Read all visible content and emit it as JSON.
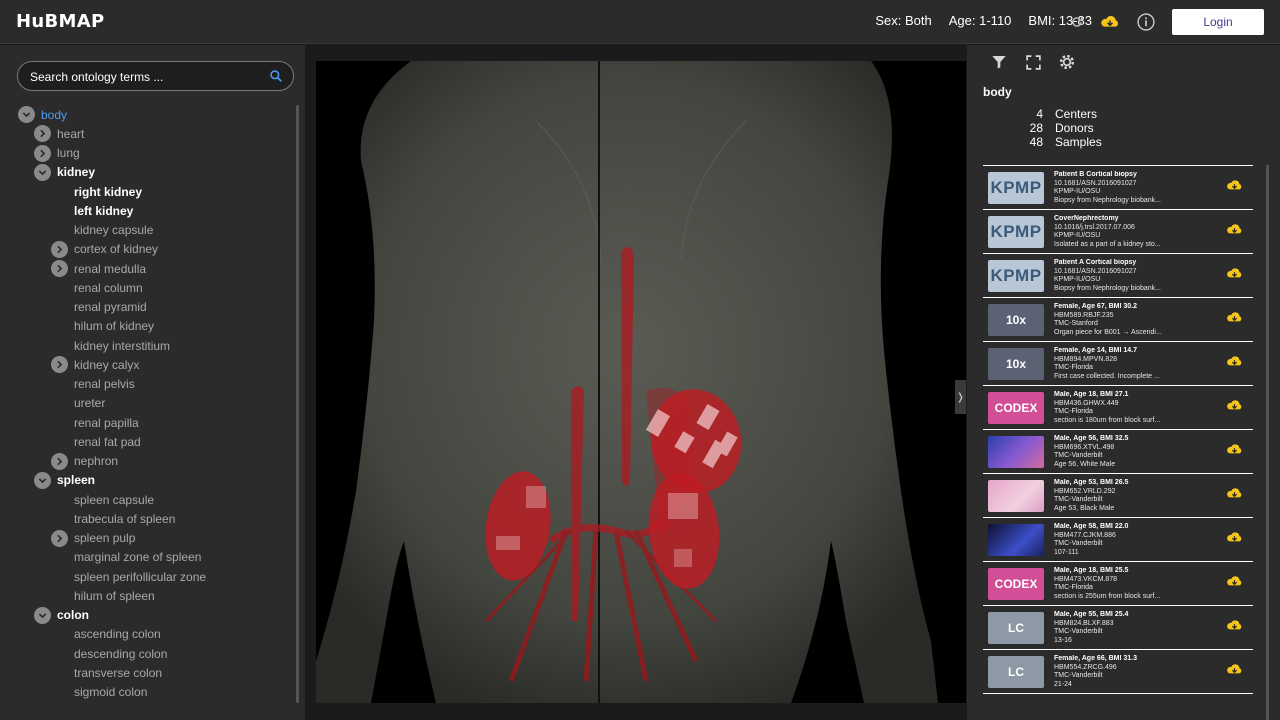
{
  "header": {
    "logo": "HuBMAP",
    "sex_filter": "Sex: Both",
    "age_filter": "Age: 1-110",
    "bmi_filter": "BMI: 13-83",
    "login_label": "Login",
    "icons": [
      "refresh-icon",
      "download-icon",
      "info-icon"
    ],
    "download_color": "#f5c518"
  },
  "search": {
    "placeholder": "Search ontology terms ..."
  },
  "tree": [
    {
      "label": "body",
      "level": 0,
      "toggle": "expanded",
      "style": "sel"
    },
    {
      "label": "heart",
      "level": 1,
      "toggle": "collapsed",
      "style": "dim"
    },
    {
      "label": "lung",
      "level": 1,
      "toggle": "collapsed",
      "style": "dim"
    },
    {
      "label": "kidney",
      "level": 1,
      "toggle": "expanded",
      "style": "bold"
    },
    {
      "label": "right kidney",
      "level": 2,
      "toggle": "none",
      "style": "bold"
    },
    {
      "label": "left kidney",
      "level": 2,
      "toggle": "none",
      "style": "bold"
    },
    {
      "label": "kidney capsule",
      "level": 2,
      "toggle": "none",
      "style": "dim"
    },
    {
      "label": "cortex of kidney",
      "level": 2,
      "toggle": "collapsed",
      "style": "dim"
    },
    {
      "label": "renal medulla",
      "level": 2,
      "toggle": "collapsed",
      "style": "dim"
    },
    {
      "label": "renal column",
      "level": 2,
      "toggle": "none",
      "style": "dim"
    },
    {
      "label": "renal pyramid",
      "level": 2,
      "toggle": "none",
      "style": "dim"
    },
    {
      "label": "hilum of kidney",
      "level": 2,
      "toggle": "none",
      "style": "dim"
    },
    {
      "label": "kidney interstitium",
      "level": 2,
      "toggle": "none",
      "style": "dim"
    },
    {
      "label": "kidney calyx",
      "level": 2,
      "toggle": "collapsed",
      "style": "dim"
    },
    {
      "label": "renal pelvis",
      "level": 2,
      "toggle": "none",
      "style": "dim"
    },
    {
      "label": "ureter",
      "level": 2,
      "toggle": "none",
      "style": "dim"
    },
    {
      "label": "renal papilla",
      "level": 2,
      "toggle": "none",
      "style": "dim"
    },
    {
      "label": "renal fat pad",
      "level": 2,
      "toggle": "none",
      "style": "dim"
    },
    {
      "label": "nephron",
      "level": 2,
      "toggle": "collapsed",
      "style": "dim"
    },
    {
      "label": "spleen",
      "level": 1,
      "toggle": "expanded",
      "style": "bold"
    },
    {
      "label": "spleen capsule",
      "level": 2,
      "toggle": "none",
      "style": "dim"
    },
    {
      "label": "trabecula of spleen",
      "level": 2,
      "toggle": "none",
      "style": "dim"
    },
    {
      "label": "spleen pulp",
      "level": 2,
      "toggle": "collapsed",
      "style": "dim"
    },
    {
      "label": "marginal zone of spleen",
      "level": 2,
      "toggle": "none",
      "style": "dim"
    },
    {
      "label": "spleen perifollicular zone",
      "level": 2,
      "toggle": "none",
      "style": "dim"
    },
    {
      "label": "hilum of spleen",
      "level": 2,
      "toggle": "none",
      "style": "dim"
    },
    {
      "label": "colon",
      "level": 1,
      "toggle": "expanded",
      "style": "bold"
    },
    {
      "label": "ascending colon",
      "level": 2,
      "toggle": "none",
      "style": "dim"
    },
    {
      "label": "descending colon",
      "level": 2,
      "toggle": "none",
      "style": "dim"
    },
    {
      "label": "transverse colon",
      "level": 2,
      "toggle": "none",
      "style": "dim"
    },
    {
      "label": "sigmoid colon",
      "level": 2,
      "toggle": "none",
      "style": "dim"
    }
  ],
  "viewer": {
    "handle_left": "❬",
    "handle_right": "❭",
    "organ_color": "#b01820"
  },
  "details": {
    "title": "body",
    "stats": [
      {
        "value": "4",
        "label": "Centers"
      },
      {
        "value": "28",
        "label": "Donors"
      },
      {
        "value": "48",
        "label": "Samples"
      }
    ],
    "tools": [
      "filter-icon",
      "fullscreen-icon",
      "settings-icon"
    ]
  },
  "cards": [
    {
      "thumb": "kpmp",
      "thumb_text": "KPMP",
      "title": "Patient B Cortical biopsy",
      "id": "10.1681/ASN.2016091027",
      "center": "KPMP-IU/OSU",
      "desc": "Biopsy from Nephrology biobank..."
    },
    {
      "thumb": "kpmp",
      "thumb_text": "KPMP",
      "title": "CoverNephrectomy",
      "id": "10.1016/j.trsl.2017.07.006",
      "center": "KPMP-IU/OSU",
      "desc": "Isolated as a part of a kidney sto..."
    },
    {
      "thumb": "kpmp",
      "thumb_text": "KPMP",
      "title": "Patient A Cortical biopsy",
      "id": "10.1681/ASN.2016091027",
      "center": "KPMP-IU/OSU",
      "desc": "Biopsy from Nephrology biobank..."
    },
    {
      "thumb": "tenx",
      "thumb_text": "10x",
      "title": "Female, Age 67, BMI 30.2",
      "id": "HBM589.RBJF.235",
      "center": "TMC-Stanford",
      "desc": "Organ piece for B001 → Ascendi..."
    },
    {
      "thumb": "tenx",
      "thumb_text": "10x",
      "title": "Female, Age 14, BMI 14.7",
      "id": "HBM894.MPVN.828",
      "center": "TMC-Florida",
      "desc": "First case collected. Incomplete ..."
    },
    {
      "thumb": "codex",
      "thumb_text": "CODEX",
      "title": "Male, Age 18, BMI 27.1",
      "id": "HBM436.GHWX.449",
      "center": "TMC-Florida",
      "desc": "section is 180um from block surf..."
    },
    {
      "thumb": "img-blue",
      "thumb_text": "",
      "title": "Male, Age 56, BMI 32.5",
      "id": "HBM696.XTVL.498",
      "center": "TMC-Vanderbilt",
      "desc": "Age 56, White Male"
    },
    {
      "thumb": "img-he",
      "thumb_text": "",
      "title": "Male, Age 53, BMI 26.5",
      "id": "HBM652.VRLD.292",
      "center": "TMC-Vanderbilt",
      "desc": "Age 53, Black Male"
    },
    {
      "thumb": "img-dark",
      "thumb_text": "",
      "title": "Male, Age 58, BMI 22.0",
      "id": "HBM477.CJKM.886",
      "center": "TMC-Vanderbilt",
      "desc": "107-111"
    },
    {
      "thumb": "codex",
      "thumb_text": "CODEX",
      "title": "Male, Age 18, BMI 25.5",
      "id": "HBM473.VKCM.878",
      "center": "TMC-Florida",
      "desc": "section is 255um from block surf..."
    },
    {
      "thumb": "lc",
      "thumb_text": "LC",
      "title": "Male, Age 55, BMI 25.4",
      "id": "HBM824.BLXF.883",
      "center": "TMC-Vanderbilt",
      "desc": "13-16"
    },
    {
      "thumb": "lc",
      "thumb_text": "LC",
      "title": "Female, Age 66, BMI 31.3",
      "id": "HBM554.ZRCG.496",
      "center": "TMC-Vanderbilt",
      "desc": "21-24"
    }
  ]
}
